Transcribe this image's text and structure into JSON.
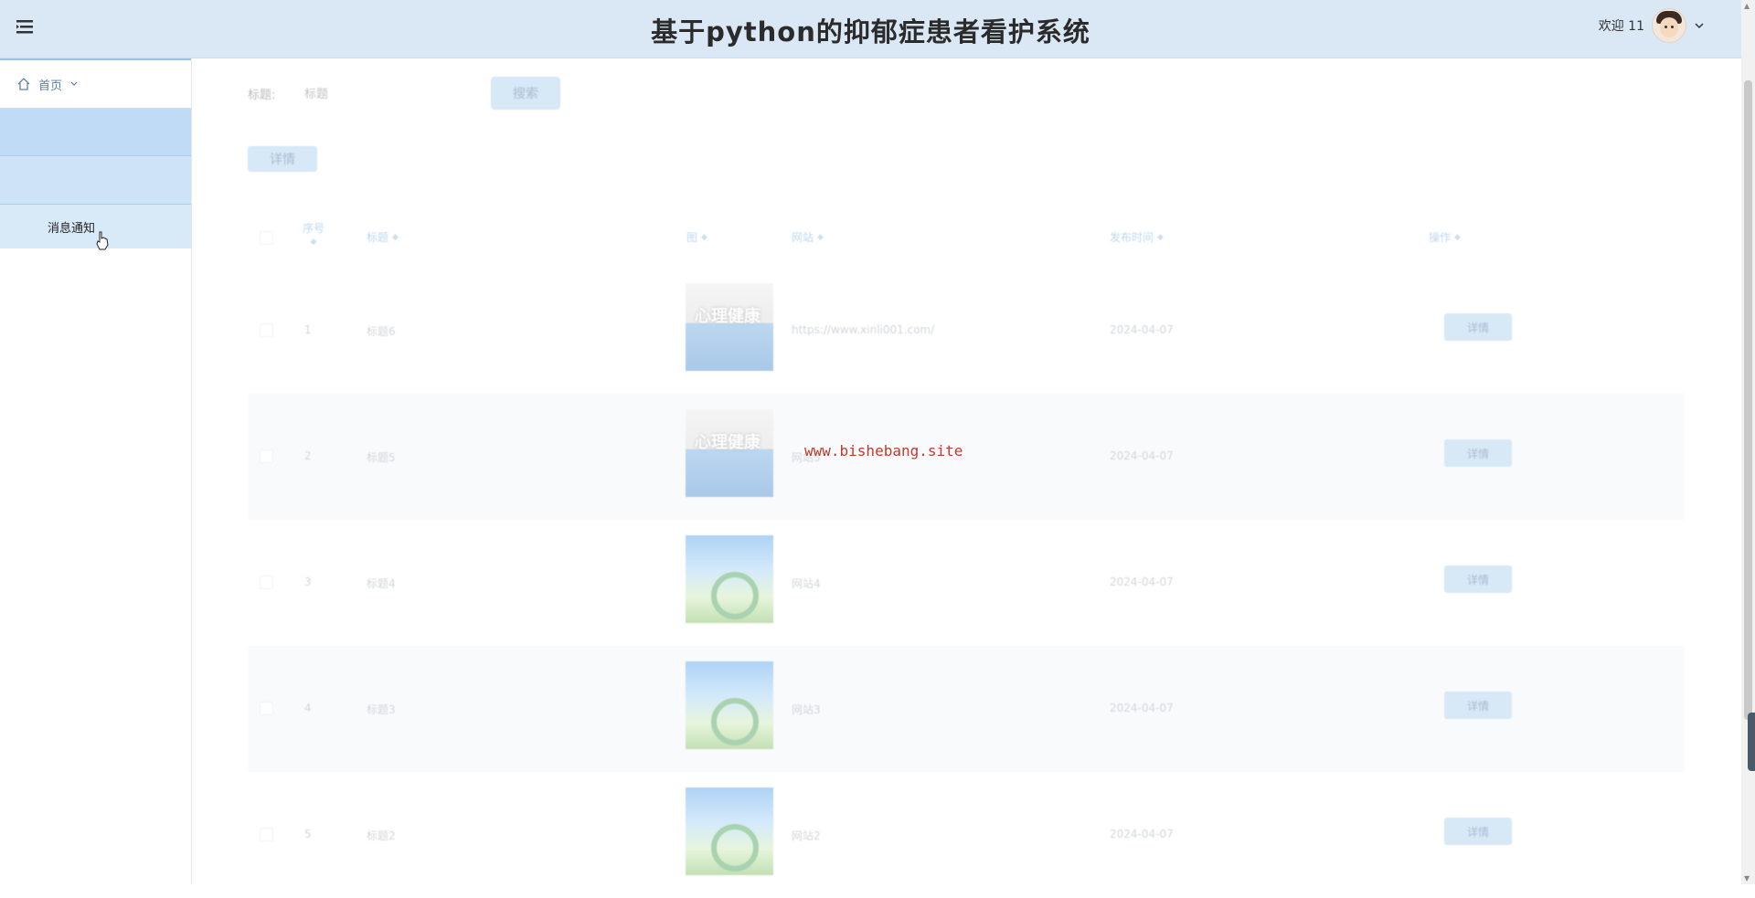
{
  "app": {
    "title": "基于python的抑郁症患者看护系统",
    "welcome": "欢迎 11"
  },
  "sidebar": {
    "home_label": "首页",
    "items": [
      {
        "label": ""
      },
      {
        "label": ""
      },
      {
        "label": "消息通知"
      }
    ]
  },
  "search": {
    "label": "标题:",
    "placeholder": "标题",
    "button_label": "搜索"
  },
  "toolbar": {
    "detail_label": "详情"
  },
  "table": {
    "headers": {
      "index": "序号",
      "title": "标题",
      "image": "图",
      "website": "网站",
      "date": "发布时间",
      "actions": "操作"
    },
    "rows": [
      {
        "index": "1",
        "title": "标题6",
        "website": "https://www.xinli001.com/",
        "date": "2024-04-07",
        "action": "详情",
        "img": "t1"
      },
      {
        "index": "2",
        "title": "标题5",
        "website": "网站5",
        "date": "2024-04-07",
        "action": "详情",
        "img": "t1"
      },
      {
        "index": "3",
        "title": "标题4",
        "website": "网站4",
        "date": "2024-04-07",
        "action": "详情",
        "img": "t2"
      },
      {
        "index": "4",
        "title": "标题3",
        "website": "网站3",
        "date": "2024-04-07",
        "action": "详情",
        "img": "t2"
      },
      {
        "index": "5",
        "title": "标题2",
        "website": "网站2",
        "date": "2024-04-07",
        "action": "详情",
        "img": "t2"
      }
    ]
  },
  "thumbnail_text": "心理健康",
  "watermark": "www.bishebang.site",
  "colors": {
    "header_bg": "#dae8f6",
    "accent": "#a6cbec",
    "header_text": "#6aa8e0",
    "watermark": "#c0392b"
  }
}
